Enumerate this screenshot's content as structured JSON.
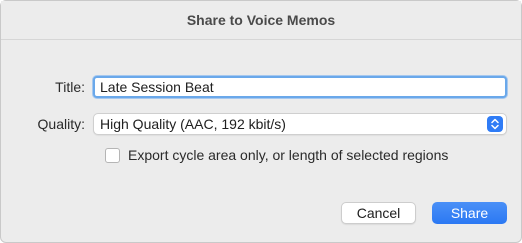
{
  "dialog": {
    "title": "Share to Voice Memos",
    "title_field": {
      "label": "Title:",
      "value": "Late Session Beat"
    },
    "quality_field": {
      "label": "Quality:",
      "selected": "High Quality (AAC, 192 kbit/s)"
    },
    "export_checkbox": {
      "label": "Export cycle area only, or length of selected regions",
      "checked": false
    },
    "buttons": {
      "cancel": "Cancel",
      "share": "Share"
    }
  },
  "colors": {
    "accent": "#2f7cf6",
    "focus_ring": "#6aa8ea"
  }
}
